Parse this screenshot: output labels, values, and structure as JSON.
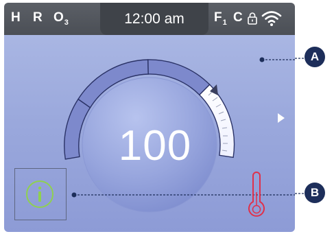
{
  "status_bar": {
    "indicators": [
      "H",
      "R",
      "O",
      "F",
      "C"
    ],
    "ozone_subscript": "3",
    "filter_subscript": "1",
    "time": "12:00 am",
    "icons": [
      "lock-icon",
      "wifi-icon"
    ]
  },
  "dial": {
    "set_temperature": "100"
  },
  "controls": {
    "info_icon": "info-icon",
    "next_icon": "chevron-right-icon",
    "thermometer_icon": "thermometer-icon"
  },
  "callouts": {
    "a": "A",
    "b": "B"
  },
  "colors": {
    "status_bar": "#4b4f56",
    "screen_bg": "#9aa8dc",
    "gauge_segment": "#7d89cc",
    "info_ring": "#8fd14f",
    "thermometer_red": "#e0304a",
    "callout_badge": "#1d2e5a"
  }
}
